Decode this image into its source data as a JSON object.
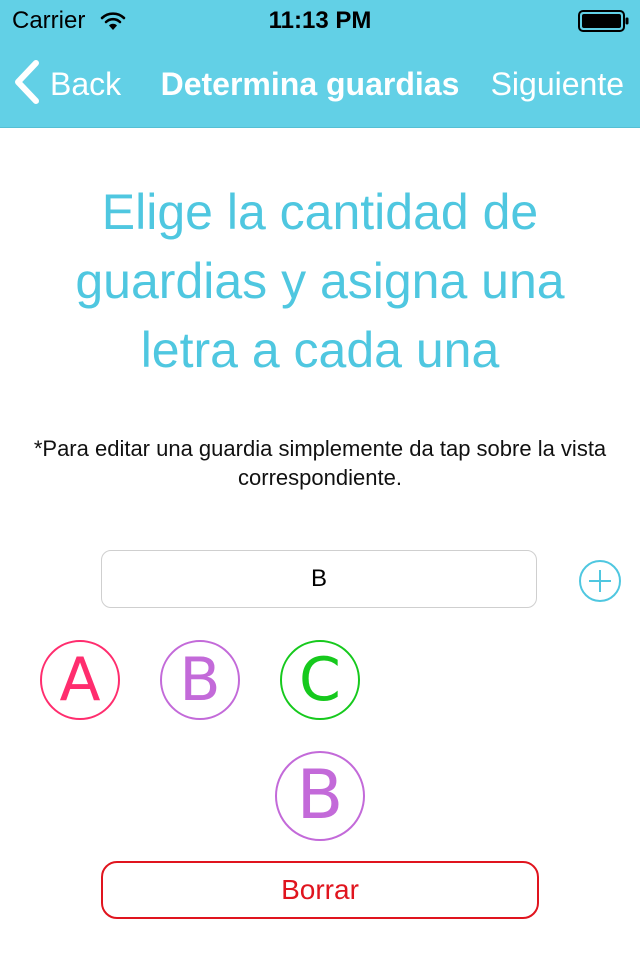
{
  "status_bar": {
    "carrier": "Carrier",
    "time": "11:13 PM",
    "wifi_icon": "wifi-icon",
    "battery_icon": "battery-icon"
  },
  "nav": {
    "back_label": "Back",
    "back_icon": "chevron-left-icon",
    "title": "Determina guardias",
    "next_label": "Siguiente"
  },
  "main": {
    "heading": "Elige la cantidad de guardias y asigna una letra a cada una",
    "note": "*Para editar una guardia simplemente da tap sobre la vista correspondiente.",
    "input_value": "B",
    "add_icon": "plus-circle-icon",
    "guards": [
      {
        "letter": "A",
        "color": "#ff2d6e"
      },
      {
        "letter": "B",
        "color": "#c36ad9"
      },
      {
        "letter": "C",
        "color": "#16c91d"
      }
    ],
    "preview": {
      "letter": "B",
      "color": "#c36ad9"
    },
    "delete_label": "Borrar",
    "delete_color": "#e0141e"
  },
  "colors": {
    "nav_background": "#62d0e6",
    "accent": "#4fc7e0",
    "nav_text": "#ffffff"
  }
}
